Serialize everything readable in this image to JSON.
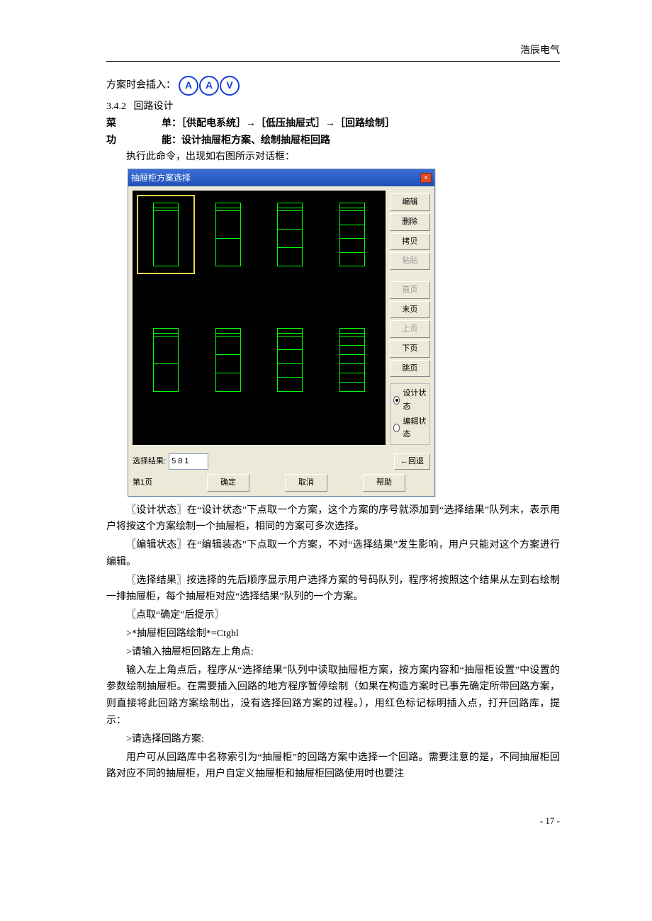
{
  "header": {
    "brand": "浩辰电气"
  },
  "intro": {
    "prefix": "方案时会插入：",
    "icons": [
      "A",
      "A",
      "V"
    ]
  },
  "section": {
    "number": "3.4.2",
    "title": "回路设计",
    "menu_label": "菜",
    "menu_suffix": "单：［供配电系统］→［低压抽屉式］→［回路绘制］",
    "func_label": "功",
    "func_suffix": "能：设计抽屉柜方案、绘制抽屉柜回路",
    "exec_line": "执行此命令，出现如右图所示对话框："
  },
  "dialog": {
    "title": "抽屉柜方案选择",
    "close": "×",
    "side_buttons": {
      "edit": "编辑",
      "delete": "删除",
      "copy": "拷贝",
      "paste": "粘贴",
      "first": "首页",
      "last": "末页",
      "prev": "上页",
      "next": "下页",
      "jump": "跳页"
    },
    "radios": {
      "design": "设计状态",
      "edit": "编辑状态"
    },
    "select_result_label": "选择结果:",
    "select_result_value": "5 8 1",
    "back": "←回退",
    "page_label": "第1页",
    "ok": "确定",
    "cancel": "取消",
    "help": "帮助"
  },
  "body": {
    "p1": "〖设计状态〗在“设计状态”下点取一个方案，这个方案的序号就添加到“选择结果”队列末，表示用户将按这个方案绘制一个抽屉柜，相同的方案可多次选择。",
    "p2": "〖编辑状态〗在“编辑装态”下点取一个方案，不对“选择结果”发生影响，用户只能对这个方案进行编辑。",
    "p3": "〖选择结果〗按选择的先后顺序显示用户选择方案的号码队列，程序将按照这个结果从左到右绘制一排抽屉柜，每个抽屉柜对应“选择结果”队列的一个方案。",
    "p4": "〖点取“确定”后提示〗",
    "p5": ">*抽屉柜回路绘制*=Ctghl",
    "p6": ">请输入抽屉柜回路左上角点:",
    "p7": "输入左上角点后，程序从“选择结果”队列中读取抽屉柜方案，按方案内容和“抽屉柜设置”中设置的参数绘制抽屉柜。在需要插入回路的地方程序暂停绘制（如果在构造方案时已事先确定所带回路方案，则直接将此回路方案绘制出，没有选择回路方案的过程。），用红色标记标明插入点，打开回路库，提示：",
    "p8": ">请选择回路方案:",
    "p9": "用户可从回路库中名称索引为“抽屉柜”的回路方案中选择一个回路。需要注意的是，不同抽屉柜回路对应不同的抽屉柜，用户自定义抽屉柜和抽屉柜回路使用时也要注"
  },
  "footer": {
    "page": "- 17 -"
  }
}
